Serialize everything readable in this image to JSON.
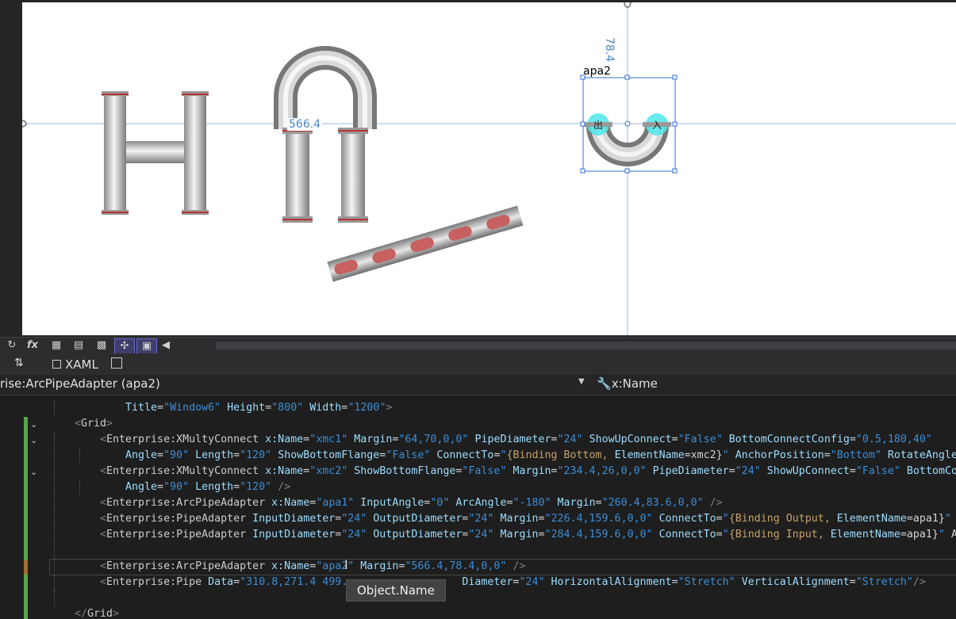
{
  "designer": {
    "guide_left_value": "566.4",
    "guide_top_value": "78.4",
    "selected_element_name": "apa2",
    "adapter_labels": {
      "output": "出",
      "input": "入"
    }
  },
  "toolbar": {
    "icons": [
      "refresh-icon",
      "fx-icon",
      "grid-icon",
      "grid-snap-icon",
      "checker-icon",
      "snap-lines-icon",
      "artboard-icon",
      "scroll-left-icon"
    ]
  },
  "tabs": {
    "swap_label": "⇅",
    "xaml_label": "XAML"
  },
  "navbar": {
    "type_selector": "rise:ArcPipeAdapter (apa2)",
    "property_selector": "x:Name"
  },
  "code_lines": [
    {
      "indent": 1,
      "segments": [
        {
          "c": "pl",
          "t": "    "
        },
        {
          "c": "an",
          "t": "Title"
        },
        {
          "c": "pl",
          "t": "="
        },
        {
          "c": "av",
          "t": "\"Window6\""
        },
        {
          "c": "pl",
          "t": " "
        },
        {
          "c": "an",
          "t": "Height"
        },
        {
          "c": "pl",
          "t": "="
        },
        {
          "c": "av",
          "t": "\"800\""
        },
        {
          "c": "pl",
          "t": " "
        },
        {
          "c": "an",
          "t": "Width"
        },
        {
          "c": "pl",
          "t": "="
        },
        {
          "c": "av",
          "t": "\"1200\""
        },
        {
          "c": "tag",
          "t": ">"
        }
      ]
    },
    {
      "indent": 0,
      "segments": [
        {
          "c": "tag",
          "t": "<"
        },
        {
          "c": "tn",
          "t": "Grid"
        },
        {
          "c": "tag",
          "t": ">"
        }
      ]
    },
    {
      "indent": 1,
      "segments": [
        {
          "c": "tag",
          "t": "<"
        },
        {
          "c": "tn",
          "t": "Enterprise:XMultyConnect"
        },
        {
          "c": "pl",
          "t": " "
        },
        {
          "c": "an",
          "t": "x:Name"
        },
        {
          "c": "pl",
          "t": "="
        },
        {
          "c": "av",
          "t": "\"xmc1\""
        },
        {
          "c": "pl",
          "t": " "
        },
        {
          "c": "an",
          "t": "Margin"
        },
        {
          "c": "pl",
          "t": "="
        },
        {
          "c": "av",
          "t": "\"64,70,0,0\""
        },
        {
          "c": "pl",
          "t": " "
        },
        {
          "c": "an",
          "t": "PipeDiameter"
        },
        {
          "c": "pl",
          "t": "="
        },
        {
          "c": "av",
          "t": "\"24\""
        },
        {
          "c": "pl",
          "t": " "
        },
        {
          "c": "an",
          "t": "ShowUpConnect"
        },
        {
          "c": "pl",
          "t": "="
        },
        {
          "c": "av",
          "t": "\"False\""
        },
        {
          "c": "pl",
          "t": " "
        },
        {
          "c": "an",
          "t": "BottomConnectConfig"
        },
        {
          "c": "pl",
          "t": "="
        },
        {
          "c": "av",
          "t": "\"0.5,180,40\""
        }
      ]
    },
    {
      "indent": 2,
      "segments": [
        {
          "c": "an",
          "t": "Angle"
        },
        {
          "c": "pl",
          "t": "="
        },
        {
          "c": "av",
          "t": "\"90\""
        },
        {
          "c": "pl",
          "t": " "
        },
        {
          "c": "an",
          "t": "Length"
        },
        {
          "c": "pl",
          "t": "="
        },
        {
          "c": "av",
          "t": "\"120\""
        },
        {
          "c": "pl",
          "t": " "
        },
        {
          "c": "an",
          "t": "ShowBottomFlange"
        },
        {
          "c": "pl",
          "t": "="
        },
        {
          "c": "av",
          "t": "\"False\""
        },
        {
          "c": "pl",
          "t": " "
        },
        {
          "c": "an",
          "t": "ConnectTo"
        },
        {
          "c": "pl",
          "t": "="
        },
        {
          "c": "av",
          "t": "\""
        },
        {
          "c": "bk",
          "t": "{Binding Bottom, "
        },
        {
          "c": "an",
          "t": "ElementName"
        },
        {
          "c": "pl",
          "t": "=xmc2}"
        },
        {
          "c": "av",
          "t": "\""
        },
        {
          "c": "pl",
          "t": " "
        },
        {
          "c": "an",
          "t": "AnchorPosition"
        },
        {
          "c": "pl",
          "t": "="
        },
        {
          "c": "av",
          "t": "\"Bottom\""
        },
        {
          "c": "pl",
          "t": " "
        },
        {
          "c": "an",
          "t": "RotateAngle"
        }
      ]
    },
    {
      "indent": 1,
      "segments": [
        {
          "c": "tag",
          "t": "<"
        },
        {
          "c": "tn",
          "t": "Enterprise:XMultyConnect"
        },
        {
          "c": "pl",
          "t": " "
        },
        {
          "c": "an",
          "t": "x:Name"
        },
        {
          "c": "pl",
          "t": "="
        },
        {
          "c": "av",
          "t": "\"xmc2\""
        },
        {
          "c": "pl",
          "t": " "
        },
        {
          "c": "an",
          "t": "ShowBottomFlange"
        },
        {
          "c": "pl",
          "t": "="
        },
        {
          "c": "av",
          "t": "\"False\""
        },
        {
          "c": "pl",
          "t": " "
        },
        {
          "c": "an",
          "t": "Margin"
        },
        {
          "c": "pl",
          "t": "="
        },
        {
          "c": "av",
          "t": "\"234.4,26,0,0\""
        },
        {
          "c": "pl",
          "t": " "
        },
        {
          "c": "an",
          "t": "PipeDiameter"
        },
        {
          "c": "pl",
          "t": "="
        },
        {
          "c": "av",
          "t": "\"24\""
        },
        {
          "c": "pl",
          "t": " "
        },
        {
          "c": "an",
          "t": "ShowUpConnect"
        },
        {
          "c": "pl",
          "t": "="
        },
        {
          "c": "av",
          "t": "\"False\""
        },
        {
          "c": "pl",
          "t": " "
        },
        {
          "c": "an",
          "t": "BottomCo"
        }
      ]
    },
    {
      "indent": 2,
      "segments": [
        {
          "c": "an",
          "t": "Angle"
        },
        {
          "c": "pl",
          "t": "="
        },
        {
          "c": "av",
          "t": "\"90\""
        },
        {
          "c": "pl",
          "t": " "
        },
        {
          "c": "an",
          "t": "Length"
        },
        {
          "c": "pl",
          "t": "="
        },
        {
          "c": "av",
          "t": "\"120\""
        },
        {
          "c": "pl",
          "t": " "
        },
        {
          "c": "tag",
          "t": "/>"
        }
      ]
    },
    {
      "indent": 1,
      "segments": [
        {
          "c": "tag",
          "t": "<"
        },
        {
          "c": "tn",
          "t": "Enterprise:ArcPipeAdapter"
        },
        {
          "c": "pl",
          "t": " "
        },
        {
          "c": "an",
          "t": "x:Name"
        },
        {
          "c": "pl",
          "t": "="
        },
        {
          "c": "av",
          "t": "\"apa1\""
        },
        {
          "c": "pl",
          "t": " "
        },
        {
          "c": "an",
          "t": "InputAngle"
        },
        {
          "c": "pl",
          "t": "="
        },
        {
          "c": "av",
          "t": "\"0\""
        },
        {
          "c": "pl",
          "t": " "
        },
        {
          "c": "an",
          "t": "ArcAngle"
        },
        {
          "c": "pl",
          "t": "="
        },
        {
          "c": "av",
          "t": "\"-180\""
        },
        {
          "c": "pl",
          "t": " "
        },
        {
          "c": "an",
          "t": "Margin"
        },
        {
          "c": "pl",
          "t": "="
        },
        {
          "c": "av",
          "t": "\"260.4,83.6,0,0\""
        },
        {
          "c": "pl",
          "t": " "
        },
        {
          "c": "tag",
          "t": "/>"
        }
      ]
    },
    {
      "indent": 1,
      "segments": [
        {
          "c": "tag",
          "t": "<"
        },
        {
          "c": "tn",
          "t": "Enterprise:PipeAdapter"
        },
        {
          "c": "pl",
          "t": " "
        },
        {
          "c": "an",
          "t": "InputDiameter"
        },
        {
          "c": "pl",
          "t": "="
        },
        {
          "c": "av",
          "t": "\"24\""
        },
        {
          "c": "pl",
          "t": " "
        },
        {
          "c": "an",
          "t": "OutputDiameter"
        },
        {
          "c": "pl",
          "t": "="
        },
        {
          "c": "av",
          "t": "\"24\""
        },
        {
          "c": "pl",
          "t": " "
        },
        {
          "c": "an",
          "t": "Margin"
        },
        {
          "c": "pl",
          "t": "="
        },
        {
          "c": "av",
          "t": "\"226.4,159.6,0,0\""
        },
        {
          "c": "pl",
          "t": " "
        },
        {
          "c": "an",
          "t": "ConnectTo"
        },
        {
          "c": "pl",
          "t": "="
        },
        {
          "c": "av",
          "t": "\""
        },
        {
          "c": "bk",
          "t": "{Binding Output, "
        },
        {
          "c": "an",
          "t": "ElementName"
        },
        {
          "c": "pl",
          "t": "=apa1}"
        },
        {
          "c": "av",
          "t": "\""
        }
      ]
    },
    {
      "indent": 1,
      "segments": [
        {
          "c": "tag",
          "t": "<"
        },
        {
          "c": "tn",
          "t": "Enterprise:PipeAdapter"
        },
        {
          "c": "pl",
          "t": " "
        },
        {
          "c": "an",
          "t": "InputDiameter"
        },
        {
          "c": "pl",
          "t": "="
        },
        {
          "c": "av",
          "t": "\"24\""
        },
        {
          "c": "pl",
          "t": " "
        },
        {
          "c": "an",
          "t": "OutputDiameter"
        },
        {
          "c": "pl",
          "t": "="
        },
        {
          "c": "av",
          "t": "\"24\""
        },
        {
          "c": "pl",
          "t": " "
        },
        {
          "c": "an",
          "t": "Margin"
        },
        {
          "c": "pl",
          "t": "="
        },
        {
          "c": "av",
          "t": "\"284.4,159.6,0,0\""
        },
        {
          "c": "pl",
          "t": " "
        },
        {
          "c": "an",
          "t": "ConnectTo"
        },
        {
          "c": "pl",
          "t": "="
        },
        {
          "c": "av",
          "t": "\""
        },
        {
          "c": "bk",
          "t": "{Binding Input, "
        },
        {
          "c": "an",
          "t": "ElementName"
        },
        {
          "c": "pl",
          "t": "=apa1}"
        },
        {
          "c": "av",
          "t": "\""
        },
        {
          "c": "pl",
          "t": " A"
        }
      ]
    },
    {
      "indent": 1,
      "segments": []
    },
    {
      "indent": 1,
      "segments": [
        {
          "c": "tag",
          "t": "<"
        },
        {
          "c": "tn",
          "t": "Enterprise:ArcPipeAdapter"
        },
        {
          "c": "pl",
          "t": " "
        },
        {
          "c": "an",
          "t": "x:Name"
        },
        {
          "c": "pl",
          "t": "="
        },
        {
          "c": "av",
          "t": "\"apa2\""
        },
        {
          "c": "pl",
          "t": " "
        },
        {
          "c": "an",
          "t": "Margin"
        },
        {
          "c": "pl",
          "t": "="
        },
        {
          "c": "av",
          "t": "\"566.4,78.4,0,0\""
        },
        {
          "c": "pl",
          "t": " "
        },
        {
          "c": "tag",
          "t": "/>"
        }
      ]
    },
    {
      "indent": 1,
      "segments": [
        {
          "c": "tag",
          "t": "<"
        },
        {
          "c": "tn",
          "t": "Enterprise:Pipe"
        },
        {
          "c": "pl",
          "t": " "
        },
        {
          "c": "an",
          "t": "Data"
        },
        {
          "c": "pl",
          "t": "="
        },
        {
          "c": "av",
          "t": "\"310.8,271.4 499."
        },
        {
          "c": "pl",
          "t": "                  "
        },
        {
          "c": "an",
          "t": "Diameter"
        },
        {
          "c": "pl",
          "t": "="
        },
        {
          "c": "av",
          "t": "\"24\""
        },
        {
          "c": "pl",
          "t": " "
        },
        {
          "c": "an",
          "t": "HorizontalAlignment"
        },
        {
          "c": "pl",
          "t": "="
        },
        {
          "c": "av",
          "t": "\"Stretch\""
        },
        {
          "c": "pl",
          "t": " "
        },
        {
          "c": "an",
          "t": "VerticalAlignment"
        },
        {
          "c": "pl",
          "t": "="
        },
        {
          "c": "av",
          "t": "\"Stretch\""
        },
        {
          "c": "tag",
          "t": "/>"
        }
      ]
    },
    {
      "indent": 1,
      "segments": []
    },
    {
      "indent": 0,
      "segments": [
        {
          "c": "tag",
          "t": "</"
        },
        {
          "c": "tn",
          "t": "Grid"
        },
        {
          "c": "tag",
          "t": ">"
        }
      ]
    }
  ],
  "tooltip": "Object.Name"
}
